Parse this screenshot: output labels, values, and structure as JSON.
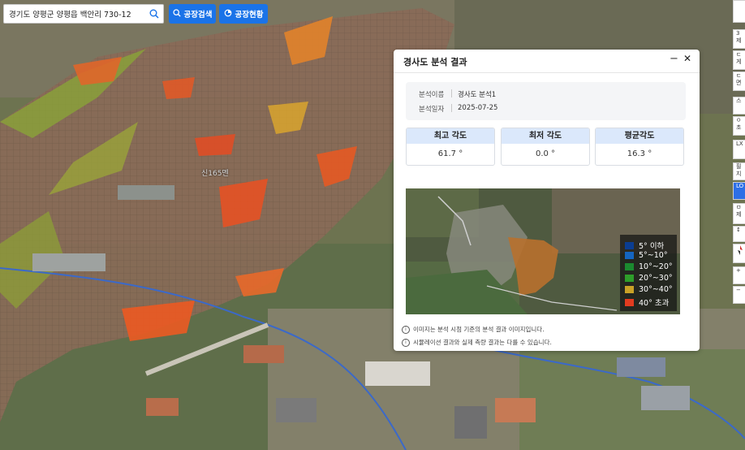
{
  "search": {
    "value": "경기도 양평군 양평읍 백안리 730-12"
  },
  "toolbar": {
    "factory_search": "공장검색",
    "factory_status": "공장현황"
  },
  "map": {
    "label": "신165멘"
  },
  "right_tools": [
    "3",
    "제",
    "ㄷ",
    "게",
    "ㄷ",
    "면",
    "스",
    "ㅇ",
    "초",
    "LX",
    "필지",
    "LO",
    "ㅁ",
    "제",
    "↕",
    "+",
    "−"
  ],
  "panel": {
    "title": "경사도 분석 결과",
    "info": {
      "name_label": "분석이름",
      "name_value": "경사도 분석1",
      "date_label": "분석일자",
      "date_value": "2025-07-25"
    },
    "stats": [
      {
        "label": "최고 각도",
        "value": "61.7 °"
      },
      {
        "label": "최저 각도",
        "value": "0.0 °"
      },
      {
        "label": "평균각도",
        "value": "16.3 °"
      }
    ],
    "legend": [
      {
        "label": "5° 이하",
        "color": "#0b3d91"
      },
      {
        "label": "5°~10°",
        "color": "#1565c0"
      },
      {
        "label": "10°~20°",
        "color": "#1b8a2f"
      },
      {
        "label": "20°~30°",
        "color": "#2e9e2a"
      },
      {
        "label": "30°~40°",
        "color": "#c9a227"
      },
      {
        "label": "40° 초과",
        "color": "#e23b1f"
      }
    ],
    "notes": [
      "이미지는 분석 시점 기준의 분석 결과 이미지입니다.",
      "시뮬레이션 결과와 실제 측량 결과는 다를 수 있습니다."
    ]
  }
}
